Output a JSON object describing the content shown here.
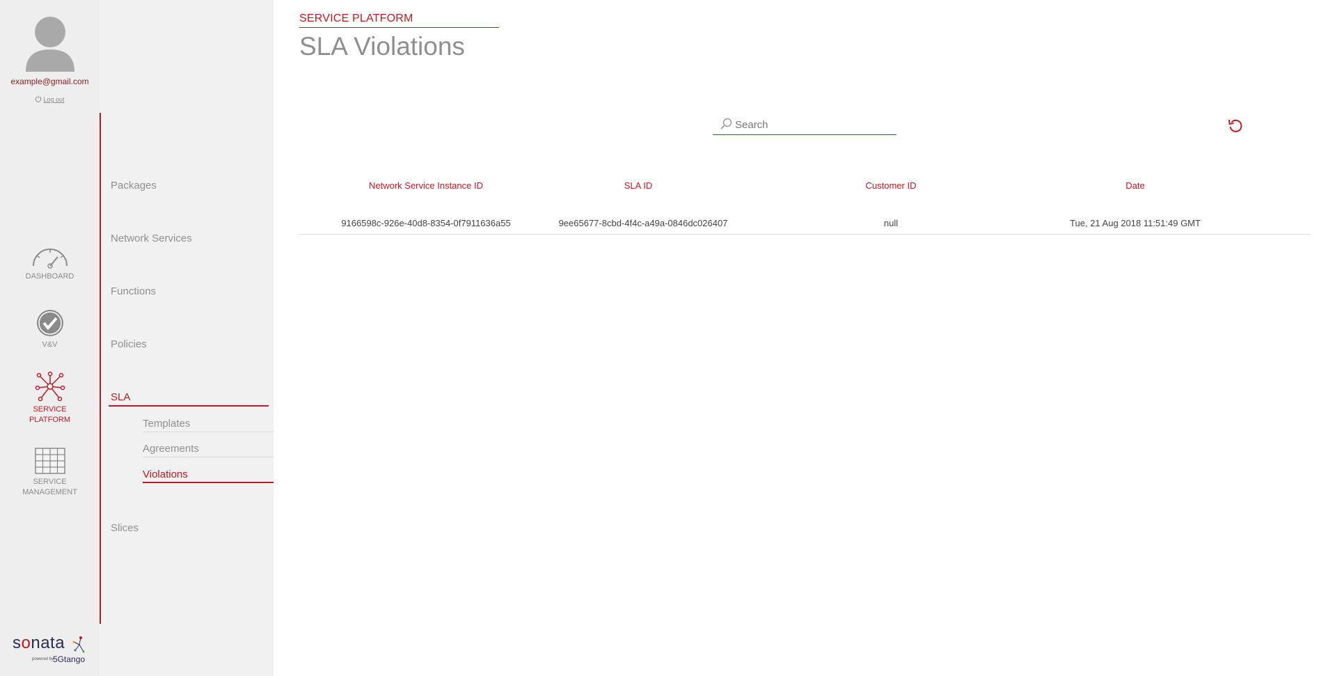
{
  "user": {
    "email": "example@gmail.com",
    "logout_label": "Log out"
  },
  "rail": {
    "items": [
      {
        "label_line1": "DASHBOARD",
        "label_line2": "",
        "icon": "dashboard-gauge-icon"
      },
      {
        "label_line1": "V&V",
        "label_line2": "",
        "icon": "checkmark-circle-icon"
      },
      {
        "label_line1": "SERVICE",
        "label_line2": "PLATFORM",
        "icon": "network-nodes-icon"
      },
      {
        "label_line1": "SERVICE",
        "label_line2": "MANAGEMENT",
        "icon": "grid-icon"
      }
    ]
  },
  "logo": {
    "brand_pre": "s",
    "brand_o": "o",
    "brand_post": "nata",
    "powered": "powered by",
    "tango": "5Gtango"
  },
  "subnav": {
    "items": [
      "Packages",
      "Network Services",
      "Functions",
      "Policies",
      "SLA",
      "Slices"
    ],
    "sla_children": [
      "Templates",
      "Agreements",
      "Violations"
    ]
  },
  "header": {
    "breadcrumb": "SERVICE PLATFORM",
    "title": "SLA Violations"
  },
  "search": {
    "placeholder": "Search",
    "value": ""
  },
  "table": {
    "columns": [
      "Network Service Instance ID",
      "SLA ID",
      "Customer ID",
      "Date"
    ],
    "rows": [
      [
        "9166598c-926e-40d8-8354-0f7911636a55",
        "9ee65677-8cbd-4f4c-a49a-0846dc026407",
        "null",
        "Tue, 21 Aug 2018 11:51:49 GMT"
      ]
    ]
  },
  "colors": {
    "accent": "#c0191f",
    "muted": "#8f8f8f",
    "rail_bg": "#eeeeee",
    "subnav_bg": "#f1f1f1"
  }
}
